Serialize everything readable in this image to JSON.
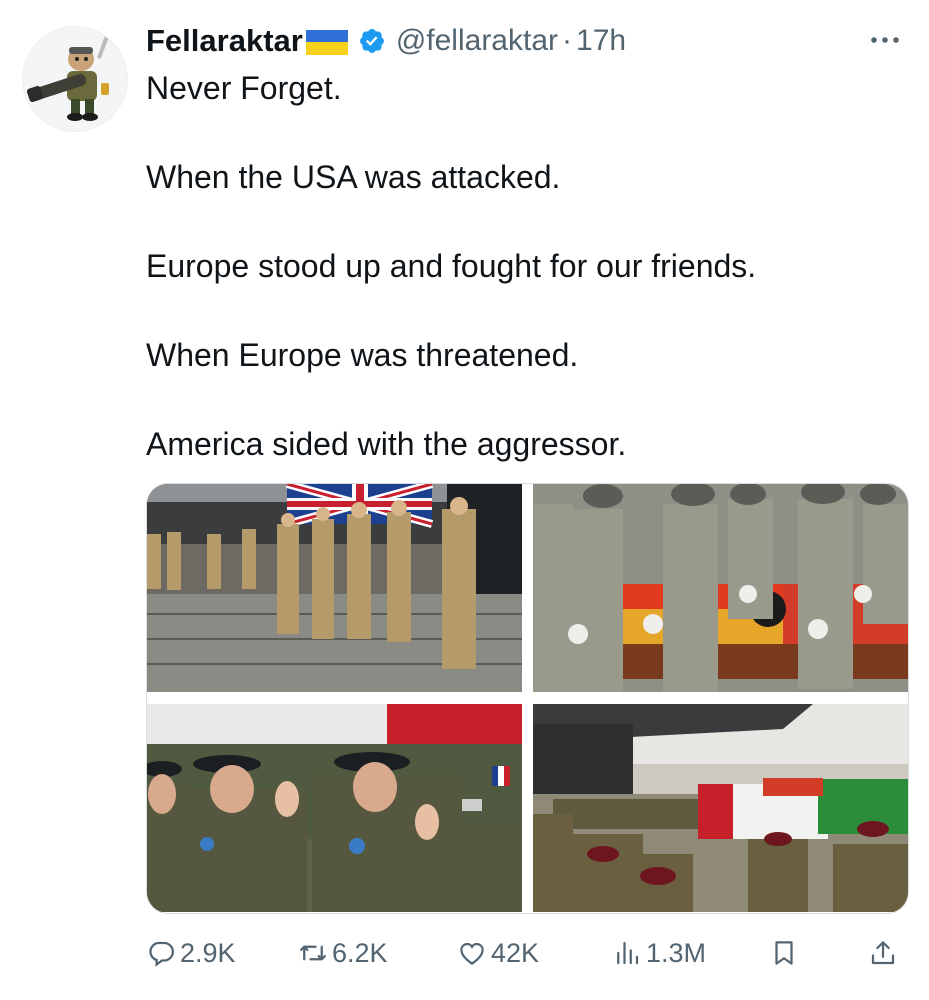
{
  "tweet": {
    "display_name": "Fellaraktar",
    "handle": "@fellaraktar",
    "separator": "·",
    "time": "17h",
    "paragraphs": [
      "Never Forget.",
      "When the USA was attacked.",
      "Europe stood up and fought for our friends.",
      "When Europe was threatened.",
      "America sided with the aggressor."
    ],
    "flag_colors": {
      "top": "#2f6fd6",
      "bottom": "#f7d21b"
    },
    "verified_color": "#1d9bf0"
  },
  "media": [
    {
      "icon": "photo-flag-draped-coffin-uk"
    },
    {
      "icon": "photo-flag-draped-coffin-germany"
    },
    {
      "icon": "photo-flag-draped-coffin-france"
    },
    {
      "icon": "photo-flag-draped-coffin-italy"
    }
  ],
  "actions": {
    "replies": "2.9K",
    "reposts": "6.2K",
    "likes": "42K",
    "views": "1.3M"
  },
  "colors": {
    "text": "#0f1419",
    "secondary": "#536471",
    "accent": "#1d9bf0"
  }
}
